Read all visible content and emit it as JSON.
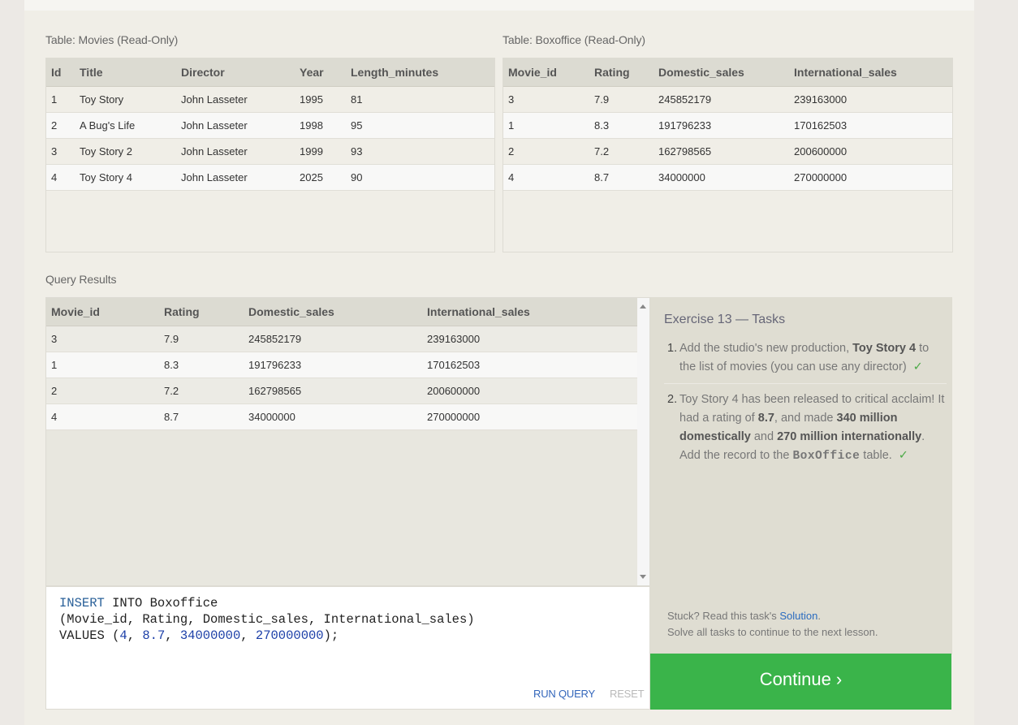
{
  "movies_table": {
    "caption": "Table: Movies (Read-Only)",
    "columns": [
      "Id",
      "Title",
      "Director",
      "Year",
      "Length_minutes"
    ],
    "rows": [
      [
        "1",
        "Toy Story",
        "John Lasseter",
        "1995",
        "81"
      ],
      [
        "2",
        "A Bug's Life",
        "John Lasseter",
        "1998",
        "95"
      ],
      [
        "3",
        "Toy Story 2",
        "John Lasseter",
        "1999",
        "93"
      ],
      [
        "4",
        "Toy Story 4",
        "John Lasseter",
        "2025",
        "90"
      ]
    ]
  },
  "boxoffice_table": {
    "caption": "Table: Boxoffice (Read-Only)",
    "columns": [
      "Movie_id",
      "Rating",
      "Domestic_sales",
      "International_sales"
    ],
    "rows": [
      [
        "3",
        "7.9",
        "245852179",
        "239163000"
      ],
      [
        "1",
        "8.3",
        "191796233",
        "170162503"
      ],
      [
        "2",
        "7.2",
        "162798565",
        "200600000"
      ],
      [
        "4",
        "8.7",
        "34000000",
        "270000000"
      ]
    ]
  },
  "query_results": {
    "caption": "Query Results",
    "columns": [
      "Movie_id",
      "Rating",
      "Domestic_sales",
      "International_sales"
    ],
    "rows": [
      [
        "3",
        "7.9",
        "245852179",
        "239163000"
      ],
      [
        "1",
        "8.3",
        "191796233",
        "170162503"
      ],
      [
        "2",
        "7.2",
        "162798565",
        "200600000"
      ],
      [
        "4",
        "8.7",
        "34000000",
        "270000000"
      ]
    ]
  },
  "editor": {
    "line1_kw": "INSERT",
    "line1_rest": " INTO Boxoffice",
    "line2": "(Movie_id, Rating, Domestic_sales, International_sales)",
    "line3_a": "VALUES (",
    "line3_n1": "4",
    "line3_s1": ", ",
    "line3_n2": "8.7",
    "line3_s2": ", ",
    "line3_n3": "34000000",
    "line3_s3": ", ",
    "line3_n4": "270000000",
    "line3_end": ");",
    "run_label": "RUN QUERY",
    "reset_label": "RESET"
  },
  "tasks": {
    "title": "Exercise 13 — Tasks",
    "task1": {
      "num": "1.",
      "pre": "Add the studio's new production, ",
      "bold": "Toy Story 4",
      "post": " to the list of movies (you can use any director)",
      "check": "✓"
    },
    "task2": {
      "num": "2.",
      "pre": "Toy Story 4 has been released to critical acclaim! It had a rating of ",
      "b1": "8.7",
      "m1": ", and made ",
      "b2": "340 million domestically",
      "m2": " and ",
      "b3": "270 million internationally",
      "m3": ". Add the record to the ",
      "code": "BoxOffice",
      "post": " table.",
      "check": "✓"
    },
    "stuck_pre": "Stuck? Read this task's ",
    "stuck_link": "Solution",
    "stuck_post": ".",
    "solve_all": "Solve all tasks to continue to the next lesson."
  },
  "continue_label": "Continue ›",
  "colors": {
    "accent_green": "#3ab44a",
    "link_blue": "#2a6bbf"
  }
}
